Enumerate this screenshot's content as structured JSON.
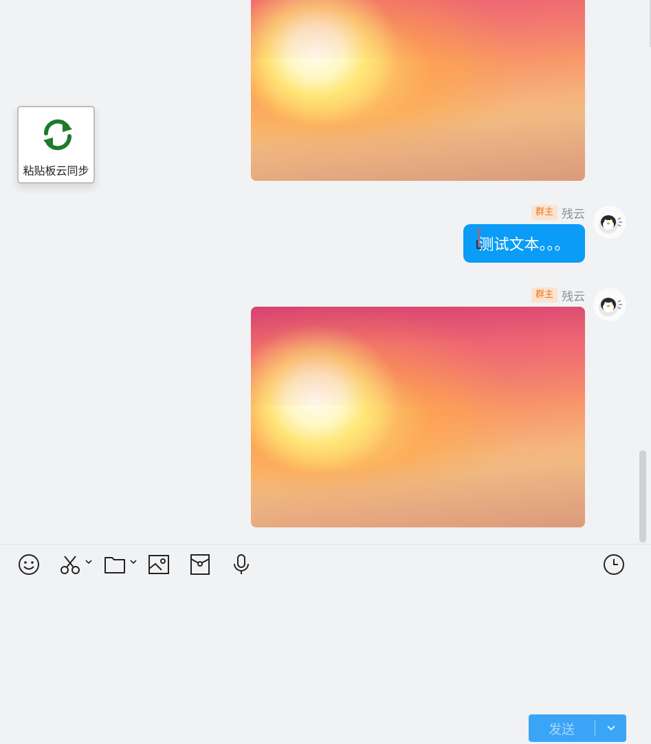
{
  "messages": [
    {
      "type": "image",
      "description": "sunset"
    },
    {
      "type": "text",
      "badge": "群主",
      "sender": "残云",
      "text": "测试文本。。。"
    },
    {
      "type": "image",
      "badge": "群主",
      "sender": "残云"
    }
  ],
  "clipboard_widget": {
    "label": "粘贴板云同步"
  },
  "toolbar": {
    "icons": [
      "emoji-icon",
      "scissors-icon",
      "folder-icon",
      "image-icon",
      "red-packet-icon",
      "microphone-icon",
      "history-clock-icon"
    ]
  },
  "send_button": {
    "label": "发送"
  },
  "colors": {
    "bubble": "#0a9cf6",
    "badge_bg": "#fbe3cf",
    "badge_text": "#e8781f",
    "send_bg": "#3aa5f6",
    "sync_icon": "#1f7a2c"
  }
}
